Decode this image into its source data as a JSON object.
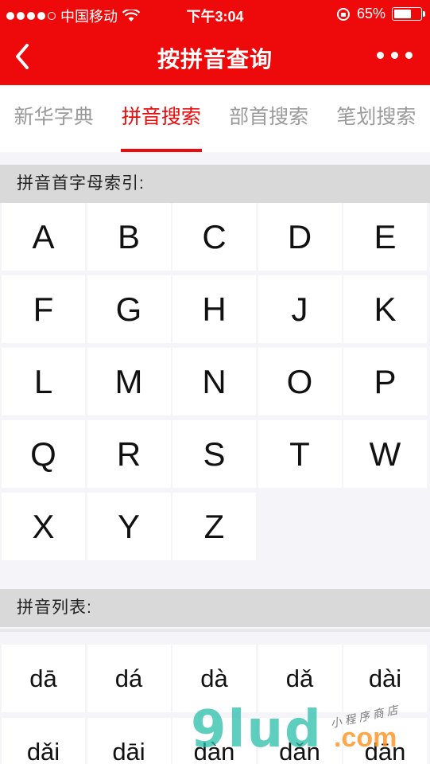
{
  "status_bar": {
    "carrier": "中国移动",
    "time": "下午3:04",
    "battery": "65%",
    "battery_level": 0.65
  },
  "nav": {
    "title": "按拼音查询"
  },
  "tabs": [
    {
      "label": "新华字典",
      "active": false
    },
    {
      "label": "拼音搜索",
      "active": true
    },
    {
      "label": "部首搜索",
      "active": false
    },
    {
      "label": "笔划搜索",
      "active": false
    }
  ],
  "index_section": {
    "header": "拼音首字母索引:",
    "letters": [
      "A",
      "B",
      "C",
      "D",
      "E",
      "F",
      "G",
      "H",
      "J",
      "K",
      "L",
      "M",
      "N",
      "O",
      "P",
      "Q",
      "R",
      "S",
      "T",
      "W",
      "X",
      "Y",
      "Z"
    ]
  },
  "pinyin_section": {
    "header": "拼音列表:",
    "items": [
      "dā",
      "dá",
      "dà",
      "dǎ",
      "dài",
      "dǎi",
      "dāi",
      "dàn",
      "dǎn",
      "dān"
    ]
  },
  "watermark": {
    "main": "9lud",
    "com": ".com",
    "sub": "小程序商店"
  },
  "colors": {
    "brand": "#ee0a0a",
    "watermark_teal": "#28beaa",
    "watermark_orange": "#ff9628"
  }
}
